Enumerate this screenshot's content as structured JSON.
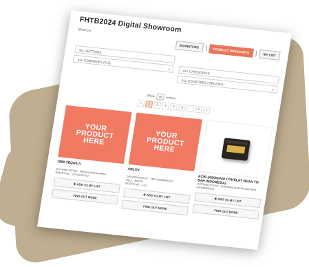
{
  "app": {
    "title": "FHTB2024 Digital Showroom",
    "search_label": "SEARCH"
  },
  "topbar": {
    "exhibitors": "EXHIBITORS",
    "highlights": "PRODUCT HIGHLIGHTS",
    "mylist": "MY LIST"
  },
  "filters": {
    "sections": "ALL SECTIONS",
    "companies": "ALL COMPANIES (A-Z)",
    "categories": "ALL CATEGORIES",
    "countries": "ALL COUNTRIES / REGIONS"
  },
  "listing": {
    "show_label": "Show",
    "show_value": "48",
    "entries_label": "entries",
    "pages": [
      "<",
      "1",
      "2",
      "3",
      "4",
      "5",
      "...",
      "8",
      ">"
    ],
    "current_page": "1"
  },
  "colors": {
    "accent": "#e8765a",
    "backdrop": "#bfae90"
  },
  "products": [
    {
      "name": "1800 TEQUILA",
      "image": "placeholder",
      "placeholder_text": "YOUR PRODUCT HERE",
      "meta": [
        "DISTRIBUTED BY : PANTAI ARTHA MAKA",
        "BOOTH NO. : ZTK3(PEC45)"
      ],
      "add_label": "✚ ADD TO MY LIST",
      "more_label": "FIND OUT MORE"
    },
    {
      "name": "ABLOY",
      "image": "placeholder",
      "placeholder_text": "YOUR PRODUCT HERE",
      "meta": [
        "DISTRIBUTED BY : YEO CAMBANGA Z",
        "HALL : BNO33",
        "BOOTH NO. : 122"
      ],
      "add_label": "✚ ADD TO MY LIST",
      "more_label": "FIND OUT MORE"
    },
    {
      "name": "ACBI (ASOSIASI COKELAT BEAN TO BAR INDONESIA)",
      "image": "chocolate-box",
      "placeholder_text": "",
      "meta": [
        "DISTRIBUTED BY : PERHIMPUNAN NUSANTARA (PERMINDUN)"
      ],
      "add_label": "✚ ADD TO MY LIST",
      "more_label": "FIND OUT MORE"
    }
  ]
}
